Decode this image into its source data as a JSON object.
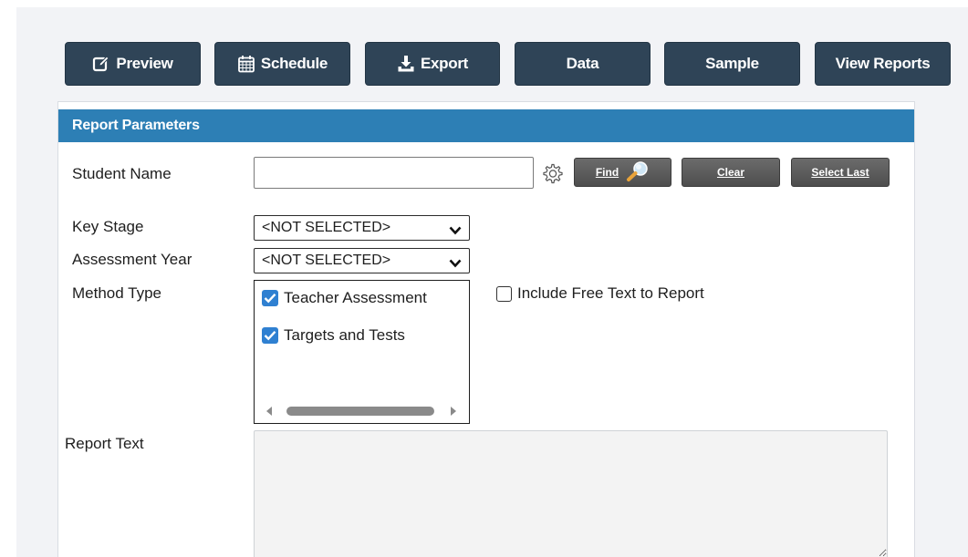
{
  "toolbar": {
    "preview": "Preview",
    "schedule": "Schedule",
    "export": "Export",
    "data": "Data",
    "sample": "Sample",
    "view_reports": "View Reports"
  },
  "panel": {
    "title": "Report Parameters"
  },
  "student": {
    "label": "Student Name",
    "value": "",
    "find": "Find",
    "clear": "Clear",
    "select_last": "Select Last"
  },
  "key_stage": {
    "label": "Key Stage",
    "selected": "<NOT SELECTED>"
  },
  "assessment_year": {
    "label": "Assessment Year",
    "selected": "<NOT SELECTED>"
  },
  "method_type": {
    "label": "Method Type",
    "options": [
      {
        "label": "Teacher Assessment",
        "checked": true
      },
      {
        "label": "Targets and Tests",
        "checked": true
      }
    ]
  },
  "free_text": {
    "label": "Include Free Text to Report",
    "checked": false
  },
  "report_text": {
    "label": "Report Text",
    "value": ""
  },
  "colors": {
    "toolbar_button": "#2f4457",
    "header": "#2d7fb5",
    "checkbox": "#2f80d1"
  }
}
